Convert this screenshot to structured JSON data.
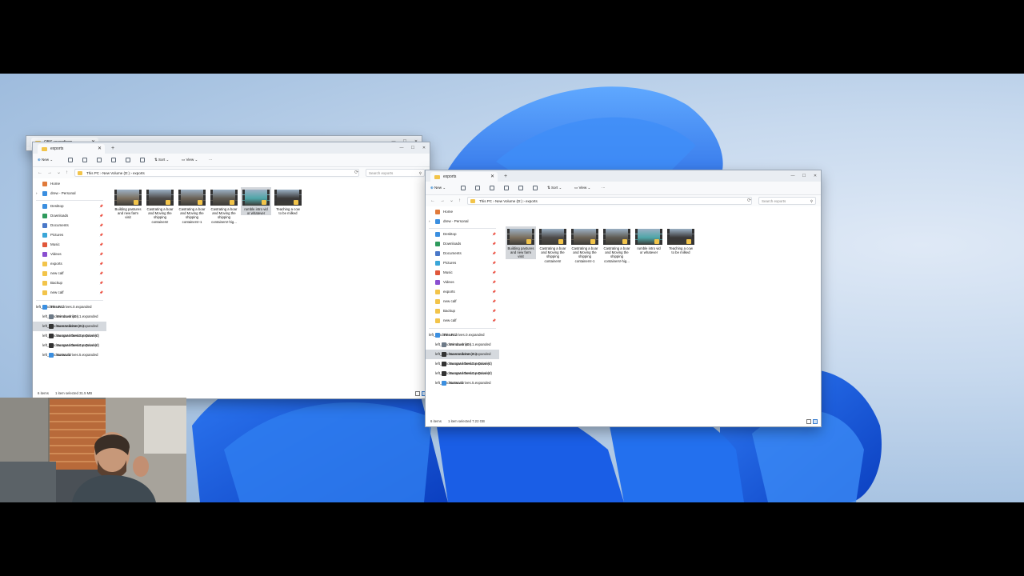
{
  "back_window": {
    "tab_title": "OBS recordings"
  },
  "left_window": {
    "tab_title": "exports",
    "toolbar": {
      "new": "New",
      "sort": "Sort",
      "view": "View",
      "more": "···"
    },
    "breadcrumb": [
      "This PC",
      "New Volume (D:)",
      "exports"
    ],
    "search_placeholder": "Search exports",
    "nav": {
      "home": "Home",
      "personal": "drew - Personal",
      "quick": [
        {
          "label": "Desktop",
          "icon": "desktop-icon",
          "color": "#3b8fe0"
        },
        {
          "label": "Downloads",
          "icon": "downloads-icon",
          "color": "#2e9a5c"
        },
        {
          "label": "Documents",
          "icon": "documents-icon",
          "color": "#4a78c8"
        },
        {
          "label": "Pictures",
          "icon": "pictures-icon",
          "color": "#3aa6d8"
        },
        {
          "label": "Music",
          "icon": "music-icon",
          "color": "#e0573a"
        },
        {
          "label": "Videos",
          "icon": "videos-icon",
          "color": "#8a4fd0"
        },
        {
          "label": "exports",
          "icon": "folder-icon",
          "color": "#f2c44a"
        },
        {
          "label": "new calf",
          "icon": "folder-icon",
          "color": "#f2c44a"
        },
        {
          "label": "Backup",
          "icon": "folder-icon",
          "color": "#f2c44a"
        },
        {
          "label": "new calf",
          "icon": "folder-icon",
          "color": "#f2c44a"
        }
      ],
      "drives": [
        {
          "label": "This PC",
          "icon": "pc-icon",
          "color": "#3b8fe0",
          "expanded": "⌄"
        },
        {
          "label": "Windows (C:)",
          "icon": "drive-icon",
          "color": "#6d7a88",
          "expanded": "›"
        },
        {
          "label": "New Volume (D:)",
          "icon": "drive-icon",
          "color": "#333",
          "expanded": "›"
        },
        {
          "label": "Seagate Desktop Drive (I:)",
          "icon": "drive-icon",
          "color": "#333",
          "expanded": "›"
        },
        {
          "label": "Seagate Desktop Drive (I:)",
          "icon": "drive-icon",
          "color": "#333",
          "expanded": "›"
        },
        {
          "label": "Network",
          "icon": "network-icon",
          "color": "#3b8fe0",
          "expanded": "›"
        }
      ]
    },
    "files": [
      {
        "name": "Building pastures and new farm visit",
        "lines": [
          "Building pastures",
          "and new farm",
          "visit"
        ],
        "thumb": "#7a6f5e"
      },
      {
        "name": "Castrating a boar and Moving the shipping containers!",
        "lines": [
          "Castrating a boar",
          "and Moving the",
          "shipping",
          "containers!"
        ],
        "thumb": "#4d4a48"
      },
      {
        "name": "Castrating a boar and Moving the shipping containers!-1",
        "lines": [
          "Castrating a boar",
          "and Moving the",
          "shipping",
          "containers!-1"
        ],
        "thumb": "#6b6256"
      },
      {
        "name": "Castrating a boar and Moving the shipping containers!-hig...",
        "lines": [
          "Castrating a boar",
          "and Moving the",
          "shipping",
          "containers!-hig..."
        ],
        "thumb": "#5e5a52"
      },
      {
        "name": "rumble intro vid or whatever",
        "lines": [
          "rumble intro vid",
          "or whatever"
        ],
        "thumb": "#4fa6a8"
      },
      {
        "name": "Teaching a cow to be milked",
        "lines": [
          "Teaching a cow",
          "to be milked"
        ],
        "thumb": "#3a3838"
      }
    ],
    "status": {
      "count": "6 items",
      "selected": "1 item selected  31.5 MB"
    }
  },
  "right_window": {
    "tab_title": "exports",
    "breadcrumb": [
      "This PC",
      "New Volume (D:)",
      "exports"
    ],
    "search_placeholder": "Search exports",
    "status": {
      "count": "6 items",
      "selected": "1 item selected  7.22 GB"
    }
  },
  "colors": {
    "folder": "#f2c44a",
    "selection": "#d4d7db",
    "accent": "#0067c0"
  }
}
